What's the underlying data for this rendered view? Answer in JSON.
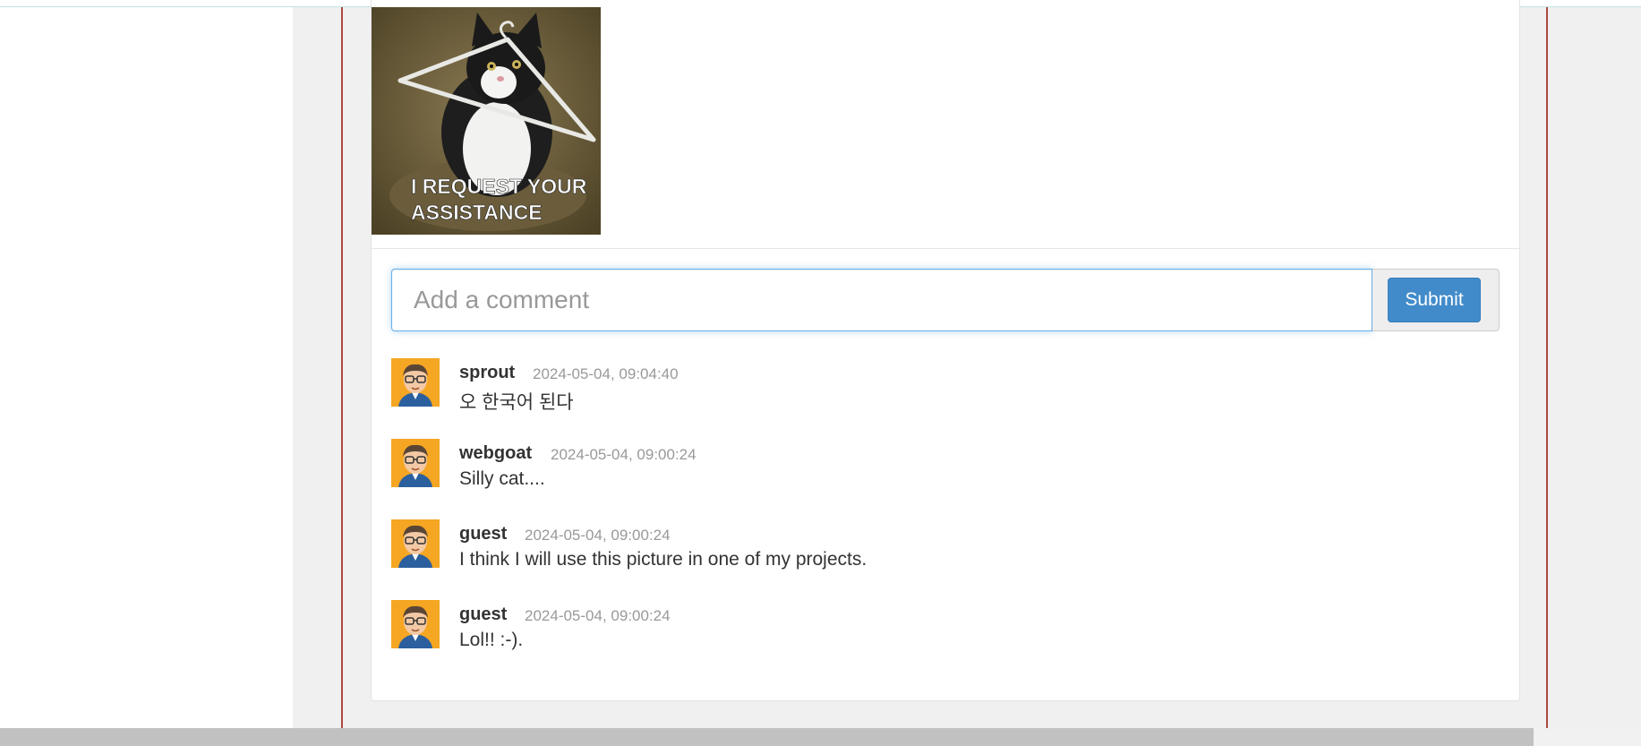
{
  "post": {
    "image_caption": "I REQUEST YOUR ASSISTANCE",
    "image_caption_line1": "I REQUEST YOUR",
    "image_caption_line2": "ASSISTANCE"
  },
  "comment_form": {
    "placeholder": "Add a comment",
    "submit_label": "Submit"
  },
  "comments": [
    {
      "user": "sprout",
      "time": "2024-05-04, 09:04:40",
      "text": "오 한국어 된다"
    },
    {
      "user": "webgoat",
      "time": "2024-05-04, 09:00:24",
      "text": "Silly cat...."
    },
    {
      "user": "guest",
      "time": "2024-05-04, 09:00:24",
      "text": "I think I will use this picture in one of my projects."
    },
    {
      "user": "guest",
      "time": "2024-05-04, 09:00:24",
      "text": "Lol!! :-)."
    }
  ],
  "colors": {
    "accent": "#428bca",
    "frame_border": "#a94a3f",
    "muted_text": "#999999"
  }
}
